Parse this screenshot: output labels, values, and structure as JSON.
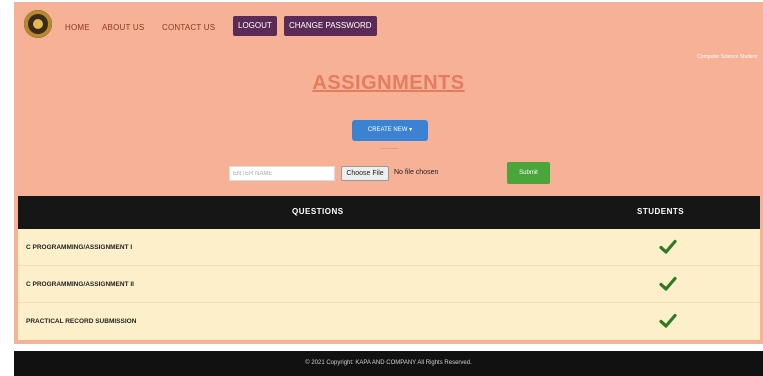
{
  "nav": {
    "links": [
      "HOME",
      "ABOUT US",
      "CONTACT US"
    ],
    "logout": "LOGOUT",
    "change_password": "CHANGE PASSWORD",
    "user_line": "Computer Science Student"
  },
  "page": {
    "title": "ASSIGNMENTS",
    "create_new": "CREATE NEW ▾"
  },
  "upload": {
    "name_placeholder": "ENTER NAME",
    "choose_file": "Choose File",
    "file_status": "No file chosen",
    "submit": "Submit"
  },
  "table": {
    "headers": {
      "questions": "QUESTIONS",
      "students": "STUDENTS"
    },
    "rows": [
      {
        "question": "C PROGRAMMING/ASSIGNMENT I"
      },
      {
        "question": "C PROGRAMMING/ASSIGNMENT II"
      },
      {
        "question": "PRACTICAL RECORD SUBMISSION"
      }
    ]
  },
  "footer": {
    "text": "© 2021 Copyright: KAPA AND COMPANY All Rights Reserved."
  },
  "colors": {
    "background": "#f6b197",
    "title": "#e57c5e",
    "nav_button": "#5c2a57",
    "create_button": "#3b82d2",
    "submit_button": "#4aa53a",
    "table_header": "#161616",
    "row": "#fdefc9",
    "check": "#2f7a25"
  }
}
